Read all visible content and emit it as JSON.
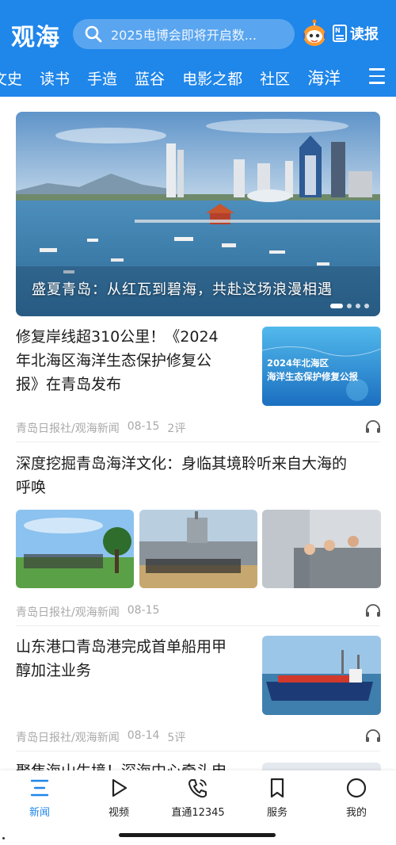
{
  "app": {
    "logo": "观海"
  },
  "search": {
    "placeholder": "2025电博会即将开启数..."
  },
  "header": {
    "paper_label": "读报",
    "paper_icon_text": "N"
  },
  "tabs": [
    {
      "label": "文史",
      "active": false
    },
    {
      "label": "读书",
      "active": false
    },
    {
      "label": "手造",
      "active": false
    },
    {
      "label": "蓝谷",
      "active": false
    },
    {
      "label": "电影之都",
      "active": false
    },
    {
      "label": "社区",
      "active": false
    },
    {
      "label": "海洋",
      "active": true
    }
  ],
  "banner": {
    "caption": "盛夏青岛：从红瓦到碧海，共赴这场浪漫相遇",
    "page_count": 4,
    "current_page": 1
  },
  "articles": [
    {
      "title_lines": [
        "修复岸线超310公里！《2024",
        "年北海区海洋生态保护修复公",
        "报》在青岛发布"
      ],
      "thumb_text_lines": [
        "2024年北海区",
        "海洋生态保护修复公报"
      ],
      "source": "青岛日报社/观海新闻",
      "date": "08-15",
      "comments": "2评"
    },
    {
      "title_lines": [
        "深度挖掘青岛海洋文化：身临其境聆听来自大海的",
        "呼唤"
      ],
      "source": "青岛日报社/观海新闻",
      "date": "08-15",
      "comments": ""
    },
    {
      "title_lines": [
        "山东港口青岛港完成首单船用甲",
        "醇加注业务"
      ],
      "source": "青岛日报社/观海新闻",
      "date": "08-14",
      "comments": "5评"
    },
    {
      "title_lines": [
        "聚焦海山生境！深海中心牵头申"
      ]
    }
  ],
  "bottom_nav": [
    {
      "label": "新闻",
      "icon": "news-list-icon",
      "active": true
    },
    {
      "label": "视频",
      "icon": "play-icon",
      "active": false
    },
    {
      "label": "直通12345",
      "icon": "phone-icon",
      "active": false
    },
    {
      "label": "服务",
      "icon": "bookmark-icon",
      "active": false
    },
    {
      "label": "我的",
      "icon": "profile-circle-icon",
      "active": false
    }
  ],
  "colors": {
    "brand": "#1f86ea",
    "meta": "#a9a9a9",
    "text": "#1c1c1c"
  }
}
